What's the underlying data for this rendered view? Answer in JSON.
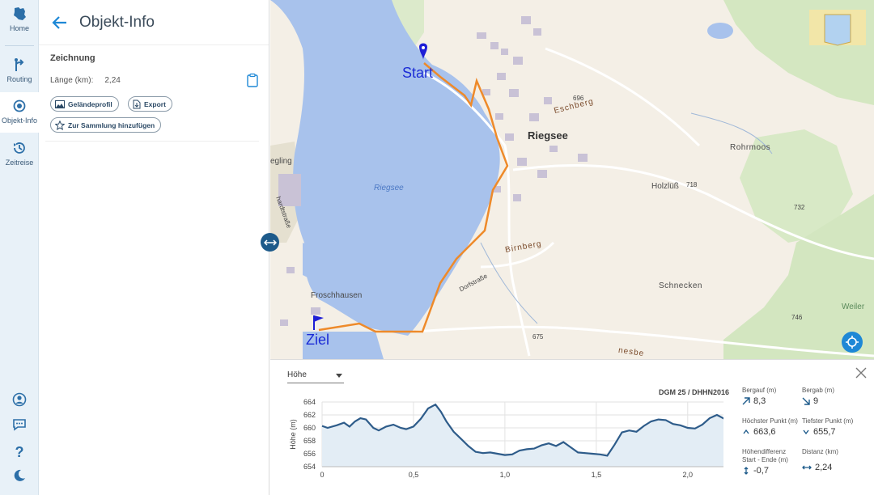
{
  "rail": {
    "home": "Home",
    "routing": "Routing",
    "objektinfo": "Objekt-Info",
    "zeitreise": "Zeitreise"
  },
  "panel": {
    "title": "Objekt-Info",
    "section": "Zeichnung",
    "length_label": "Länge (km):",
    "length_value": "2,24",
    "btn_profile": "Geländeprofil",
    "btn_export": "Export",
    "btn_collection": "Zur Sammlung hinzufügen"
  },
  "map": {
    "start": "Start",
    "ziel": "Ziel",
    "riegsee_town": "Riegsee",
    "riegsee_lake": "Riegsee",
    "froschhausen": "Froschhausen",
    "eschberg": "Eschberg",
    "birnberg": "Birnberg",
    "rohrmoos": "Rohrmoos",
    "holzluess": "Holzlüß",
    "schnecken": "Schnecken",
    "weiler": "Weiler",
    "dorfstrasse": "Dorfstraße",
    "egling": "egling",
    "hardtstrasse": "hardtstraße",
    "nesbe": "nesbe",
    "h696": "696",
    "h718": "718",
    "h732": "732",
    "h746": "746",
    "h675": "675"
  },
  "profile": {
    "select_value": "Höhe",
    "source": "DGM 25 / DHHN2016",
    "stats": {
      "bergauf_label": "Bergauf (m)",
      "bergauf": "8,3",
      "bergab_label": "Bergab (m)",
      "bergab": "9",
      "hoechster_label": "Höchster Punkt (m)",
      "hoechster": "663,6",
      "tiefster_label": "Tiefster Punkt (m)",
      "tiefster": "655,7",
      "diff_label": "Höhendifferenz Start - Ende (m)",
      "diff": "-0,7",
      "distanz_label": "Distanz (km)",
      "distanz": "2,24"
    }
  },
  "chart_data": {
    "type": "area",
    "ylabel": "Höhe (m)",
    "xlabel": "",
    "ylim": [
      654,
      664
    ],
    "xlim": [
      0,
      2.24
    ],
    "yticks": [
      "654",
      "656",
      "658",
      "660",
      "662",
      "664"
    ],
    "xticks": [
      {
        "v": 0,
        "t": "0"
      },
      {
        "v": 0.5,
        "t": "0,5"
      },
      {
        "v": 1.0,
        "t": "1,0"
      },
      {
        "v": 1.5,
        "t": "1,5"
      },
      {
        "v": 2.0,
        "t": "2,0"
      }
    ],
    "x": [
      0,
      0.03,
      0.08,
      0.12,
      0.15,
      0.18,
      0.21,
      0.24,
      0.28,
      0.31,
      0.35,
      0.39,
      0.43,
      0.46,
      0.5,
      0.54,
      0.58,
      0.62,
      0.65,
      0.68,
      0.72,
      0.76,
      0.8,
      0.84,
      0.88,
      0.92,
      0.96,
      1.0,
      1.04,
      1.08,
      1.12,
      1.16,
      1.2,
      1.24,
      1.28,
      1.32,
      1.36,
      1.4,
      1.44,
      1.48,
      1.52,
      1.56,
      1.6,
      1.64,
      1.68,
      1.72,
      1.76,
      1.8,
      1.84,
      1.88,
      1.92,
      1.96,
      2.0,
      2.04,
      2.08,
      2.12,
      2.16,
      2.2,
      2.24
    ],
    "values": [
      660.3,
      660.0,
      660.4,
      660.8,
      660.2,
      661.0,
      661.5,
      661.3,
      660.0,
      659.6,
      660.2,
      660.5,
      660.0,
      659.8,
      660.2,
      661.4,
      663.0,
      663.6,
      662.5,
      661.0,
      659.4,
      658.3,
      657.2,
      656.3,
      656.1,
      656.2,
      656.0,
      655.8,
      655.9,
      656.5,
      656.7,
      656.8,
      657.3,
      657.6,
      657.2,
      657.8,
      657.0,
      656.2,
      656.1,
      656.0,
      655.9,
      655.7,
      657.4,
      659.3,
      659.6,
      659.4,
      660.3,
      661.0,
      661.3,
      661.2,
      660.6,
      660.4,
      660.0,
      659.9,
      660.5,
      661.5,
      662.0,
      661.4,
      659.8
    ],
    "colors": {
      "line": "#2e5c8a",
      "fill": "#e3edf5",
      "grid": "#e2e2e2"
    }
  }
}
